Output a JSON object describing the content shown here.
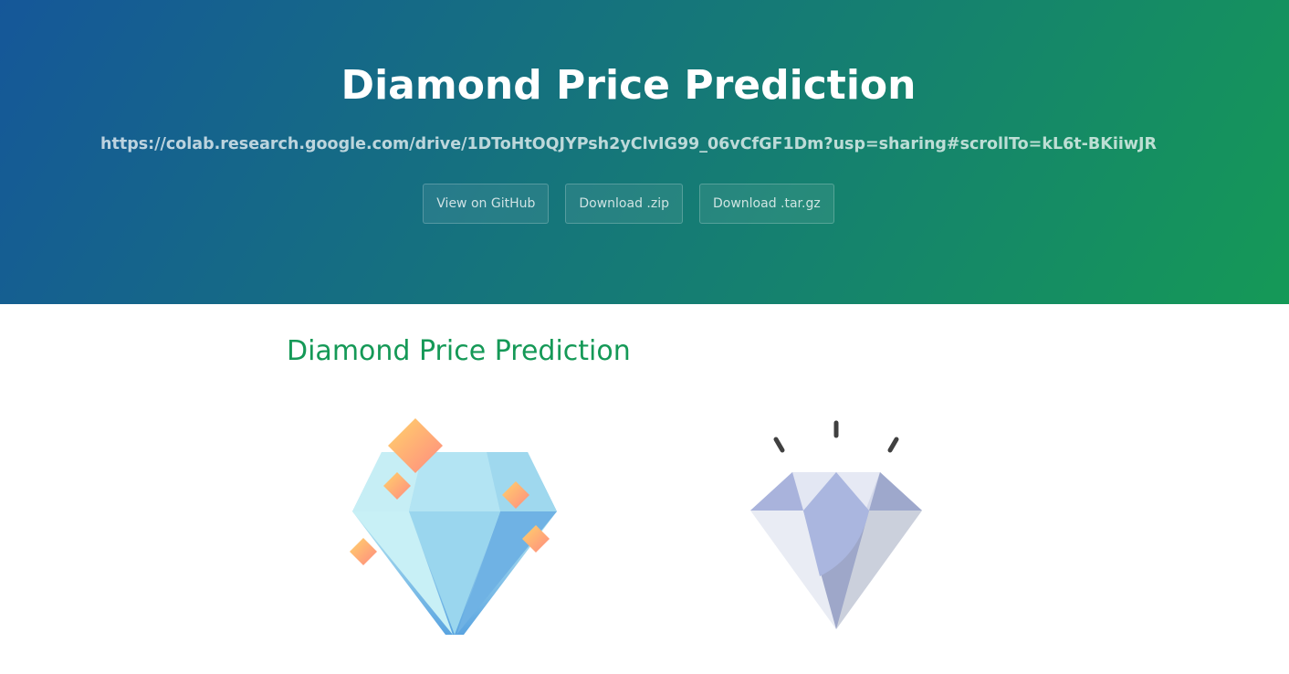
{
  "header": {
    "title": "Diamond Price Prediction",
    "tagline": "https://colab.research.google.com/drive/1DToHtOQJYPsh2yClvIG99_06vCfGF1Dm?usp=sharing#scrollTo=kL6t-BKiiwJR",
    "buttons": {
      "github": "View on GitHub",
      "zip": "Download .zip",
      "targz": "Download .tar.gz"
    },
    "gradient_start": "#155799",
    "gradient_end": "#159957"
  },
  "main": {
    "heading": "Diamond Price Prediction",
    "heading_color": "#159957",
    "images": [
      {
        "name": "sparkling-blue-diamond-icon"
      },
      {
        "name": "shining-lavender-diamond-icon"
      }
    ]
  }
}
